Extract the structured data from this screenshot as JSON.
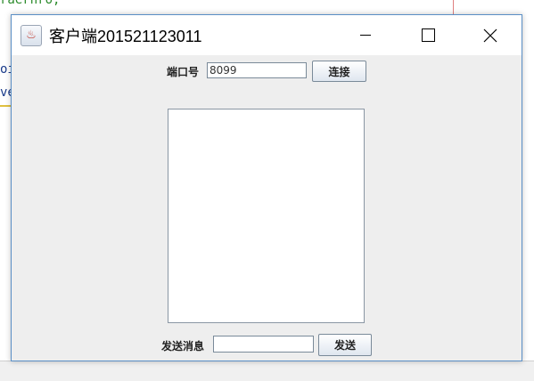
{
  "background": {
    "code_line_1": "raernro,",
    "code_line_2": "oi",
    "code_line_3": "ve"
  },
  "window": {
    "title": "客户端201521123011",
    "port_label": "端口号",
    "port_value": "8099",
    "connect_label": "连接",
    "message_label": "发送消息",
    "message_value": "",
    "send_label": "发送",
    "chat_text": ""
  },
  "colors": {
    "window_bg": "#eeeeee",
    "border": "#5a8fc6"
  },
  "icons": {
    "app": "java-icon",
    "minimize": "minimize-icon",
    "maximize": "maximize-icon",
    "close": "close-icon"
  }
}
